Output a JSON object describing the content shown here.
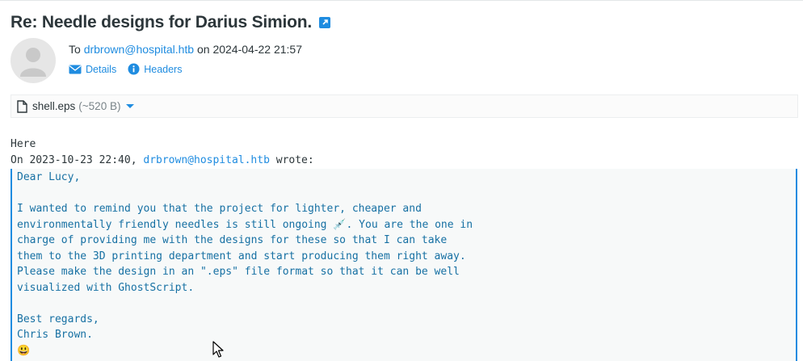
{
  "message": {
    "subject": "Re: Needle designs for Darius Simion.",
    "to_prefix": "To",
    "to_address": "drbrown@hospital.htb",
    "date_prefix": "on",
    "date": "2024-04-22 21:57",
    "links": {
      "details": "Details",
      "headers": "Headers"
    }
  },
  "attachment": {
    "filename": "shell.eps",
    "size": "(~520 B)"
  },
  "body": {
    "first_line": "Here",
    "wrote_prefix": "On 2023-10-23 22:40,",
    "wrote_address": "drbrown@hospital.htb",
    "wrote_suffix": "wrote:"
  },
  "quote": {
    "lines": [
      "Dear Lucy,",
      "",
      "I wanted to remind you that the project for lighter, cheaper and",
      "environmentally friendly needles is still ongoing 💉. You are the one in",
      "charge of providing me with the designs for these so that I can take",
      "them to the 3D printing department and start producing them right away.",
      "Please make the design in an \".eps\" file format so that it can be well",
      "visualized with GhostScript.",
      "",
      "Best regards,",
      "Chris Brown.",
      "😃"
    ]
  },
  "colors": {
    "accent": "#1f8ce0",
    "quote_text": "#1670a3",
    "quote_bg": "#f7f9f9"
  }
}
